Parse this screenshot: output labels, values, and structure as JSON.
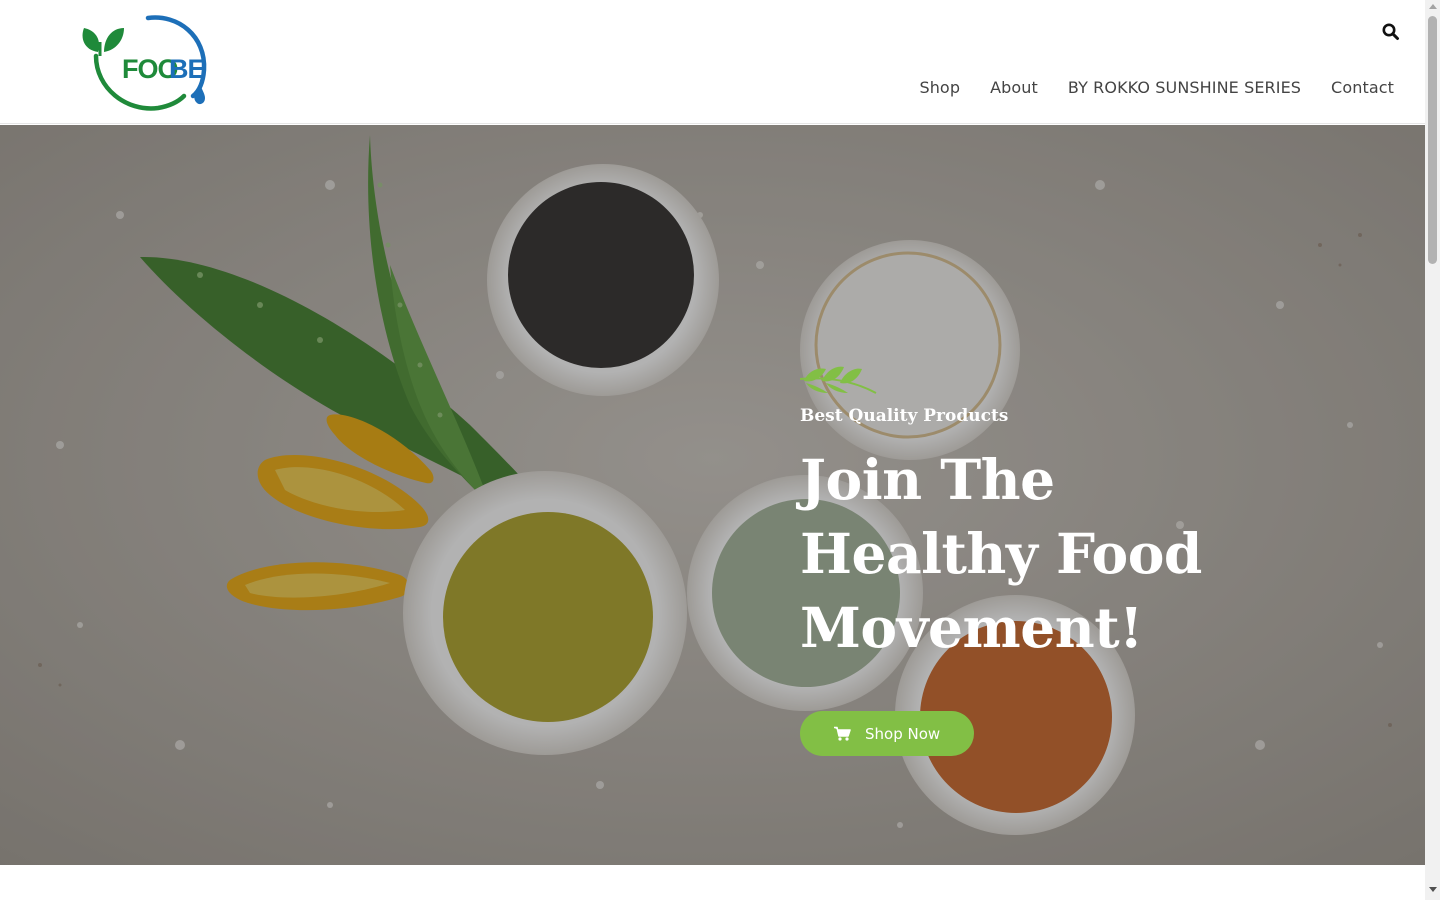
{
  "header": {
    "logo_text": "FOOBE",
    "search_icon": "search-icon",
    "nav": [
      {
        "label": "Shop"
      },
      {
        "label": "About"
      },
      {
        "label": "BY ROKKO SUNSHINE SERIES"
      },
      {
        "label": "Contact"
      }
    ]
  },
  "hero": {
    "ornament_icon": "leaf-sprig-icon",
    "kicker": "Best Quality Products",
    "headline": "Join The Healthy Food Movement!",
    "button": {
      "label": "Shop Now",
      "icon": "cart-icon"
    }
  },
  "colors": {
    "accent_green": "#82bf45",
    "nav_text": "#444444",
    "logo_green": "#1f8a3a",
    "logo_blue": "#1d6fb8"
  }
}
